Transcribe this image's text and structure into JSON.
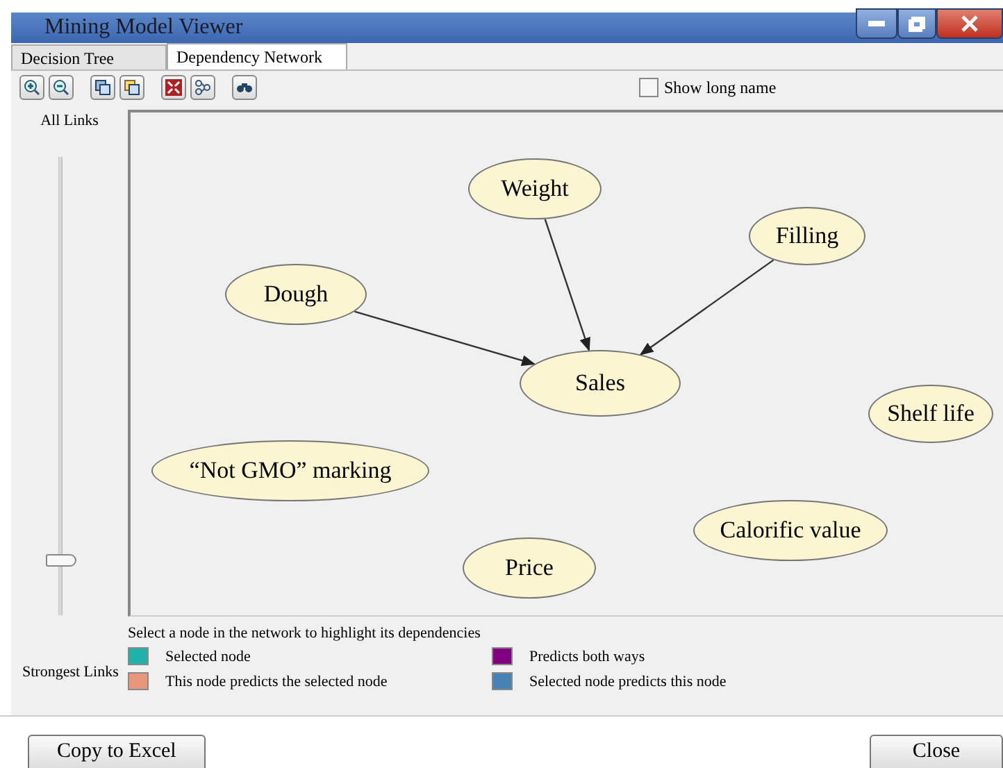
{
  "window": {
    "title": "Mining Model Viewer"
  },
  "tabs": [
    {
      "label": "Decision Tree",
      "selected": false
    },
    {
      "label": "Dependency Network",
      "selected": true
    }
  ],
  "toolbar": {
    "show_long_name": {
      "label": "Show long name",
      "checked": false
    }
  },
  "slider": {
    "top_label": "All Links",
    "bottom_label": "Strongest Links",
    "level": 0.12
  },
  "nodes": [
    {
      "label": "Weight"
    },
    {
      "label": "Filling"
    },
    {
      "label": "Dough"
    },
    {
      "label": "Sales"
    },
    {
      "label": "Shelf life"
    },
    {
      "label": "“Not GMO” marking"
    },
    {
      "label": "Calorific value"
    },
    {
      "label": "Price"
    }
  ],
  "hint": "Select a node in the network to highlight its dependencies",
  "legend": [
    {
      "label": "Selected node",
      "color": "#20b2aa"
    },
    {
      "label": "Predicts both ways",
      "color": "#800080"
    },
    {
      "label": "This node predicts the selected node",
      "color": "#e9967a"
    },
    {
      "label": "Selected node predicts this node",
      "color": "#4682b4"
    }
  ],
  "buttons": [
    {
      "label": "Copy to Excel"
    },
    {
      "label": "Close"
    }
  ]
}
